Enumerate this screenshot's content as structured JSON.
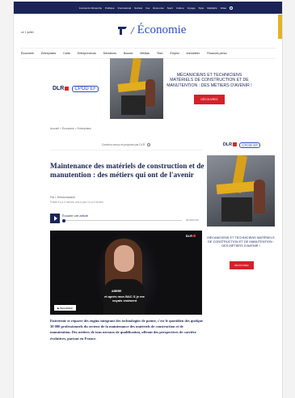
{
  "topnav": {
    "items": [
      "Journal du Dimanche",
      "Politique",
      "International",
      "Société",
      "Vue",
      "Économie",
      "Sport",
      "Culture",
      "Voyage",
      "Style",
      "Médiathé",
      "Vidéo"
    ]
  },
  "header": {
    "date": "ce 1 juillet",
    "logo_text": "Économie",
    "logo_separator": "/"
  },
  "subnav": {
    "items": [
      "Économie",
      "Entreprises",
      "Carte",
      "Entrepreneurs",
      "Décideurs",
      "Bourse",
      "Médias",
      "Tech",
      "Emploi",
      "Immobilier",
      "Finances perso"
    ]
  },
  "banner": {
    "logo_dlr": "DLR",
    "logo_cpo": "CPOD EF",
    "headline": "MÉCANICIENS ET TECHNICIENS MATÉRIELS DE CONSTRUCTION ET DE MANUTENTION : DES MÉTIERS D'AVENIR !",
    "button": "DÉCOUVREZ"
  },
  "article": {
    "breadcrumb": "Accueil > Économie > Entreprises",
    "sponsor_note": "Contenu conçu et proposé par DLR",
    "title": "Maintenance des matériels de construction et de manutention : des métiers qui ont de l'avenir",
    "author": "Par L'Hebdomadaire",
    "dates": "Publié il y a 4 heures, mis à jour il y a 4 heures",
    "audio_label": "Écouter cet article",
    "audio_time": "00:00/04:00",
    "lead": "Entretenir et réparer des engins intégrant des technologies de pointe, c'est le quotidien des quelque 30 000 professionnels du secteur de la maintenance des matériels de construction et de manutention. Des métiers de tous niveaux de qualification, offrant des perspectives de carrière évolutives, partout en France."
  },
  "video": {
    "logo": "DLR",
    "caption_name": "AMBRE",
    "caption_text": "et après mon BAC S je me voyais vraiment",
    "watch_label": "REGARDER"
  },
  "side_ad": {
    "logo_dlr": "DLR",
    "logo_cpo": "CPOD EF",
    "headline": "MÉCANICIENS ET TECHNICIENS MATÉRIELS DE CONSTRUCTION ET DE MANUTENTION : DES MÉTIERS D'AVENIR !",
    "button": "DÉCOUVREZ"
  },
  "colors": {
    "navy": "#1b2456",
    "accent_red": "#d4212a",
    "brand_blue": "#2c4ec2",
    "yellow": "#e5b321"
  }
}
